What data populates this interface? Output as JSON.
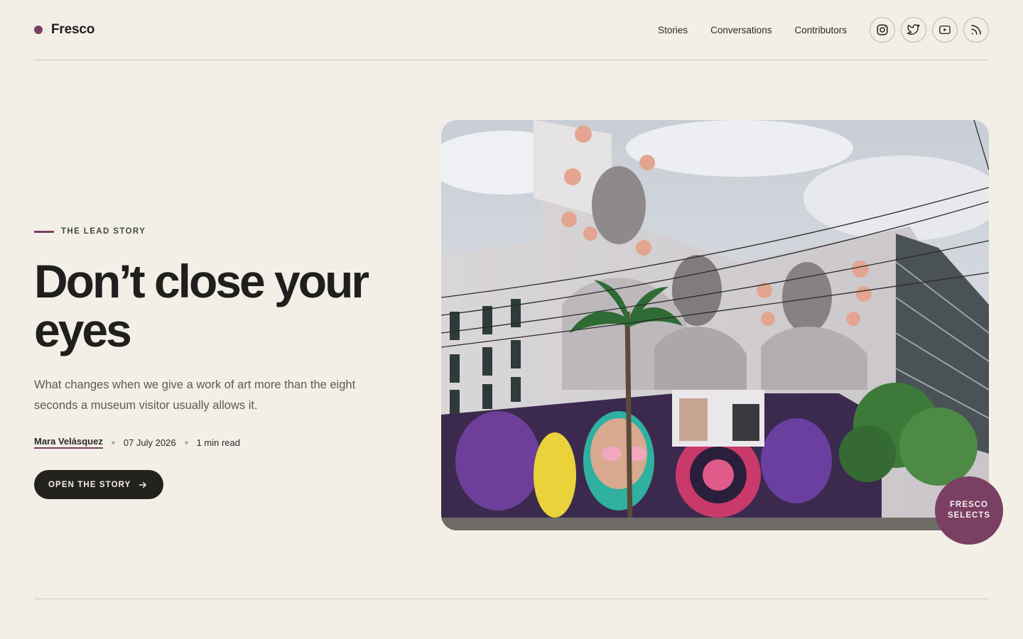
{
  "brand": {
    "name": "Fresco",
    "accent": "#7a3f62"
  },
  "nav": {
    "links": [
      "Stories",
      "Conversations",
      "Contributors"
    ],
    "socials": [
      {
        "icon": "instagram-icon"
      },
      {
        "icon": "twitter-icon"
      },
      {
        "icon": "youtube-icon"
      },
      {
        "icon": "rss-icon"
      }
    ]
  },
  "hero": {
    "eyebrow": "THE LEAD STORY",
    "headline": "Don’t close your eyes",
    "dek": "What changes when we give a work of art more than the eight seconds a museum visitor usually allows it.",
    "author": "Mara Velásquez",
    "date": "07 July 2026",
    "read_time": "1 min read",
    "cta_label": "OPEN THE STORY",
    "badge_line1": "FRESCO",
    "badge_line2": "SELECTS"
  },
  "colors": {
    "background": "#f3efe7",
    "ink": "#1f1f1d",
    "accent": "#7a3f62",
    "eyebrow": "#3e4a3c"
  }
}
